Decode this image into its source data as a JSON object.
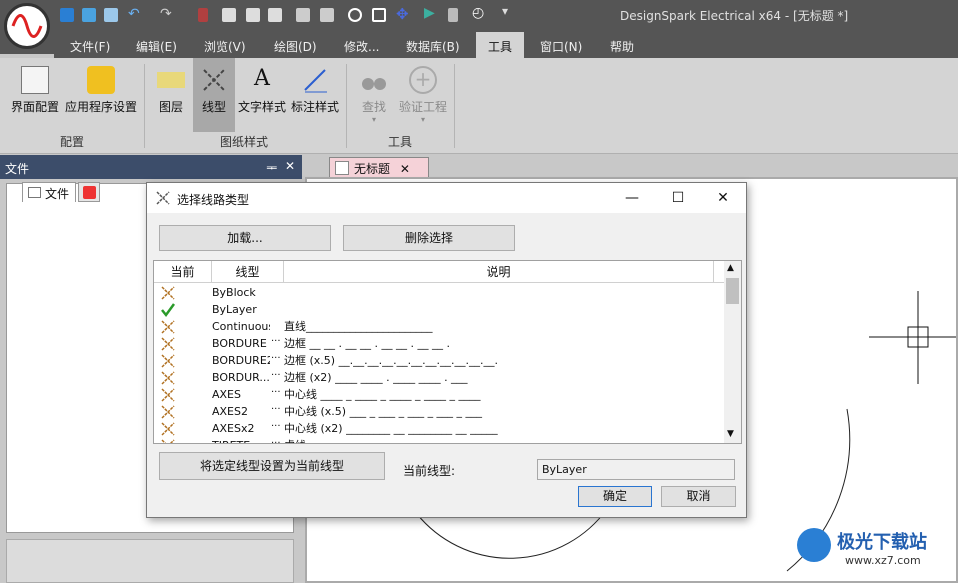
{
  "app": {
    "title": "DesignSpark Electrical x64 - [无标题 *]"
  },
  "menus": [
    "文件(F)",
    "编辑(E)",
    "浏览(V)",
    "绘图(D)",
    "修改...",
    "数据库(B)",
    "工具",
    "窗口(N)",
    "帮助"
  ],
  "ribbon": {
    "buttons": {
      "ui_config": "界面配置",
      "app_settings": "应用程序设置",
      "layers": "图层",
      "linetype": "线型",
      "text_style": "文字样式",
      "dim_style": "标注样式",
      "find": "查找",
      "verify": "验证工程"
    },
    "groups": {
      "config": "配置",
      "sheet_style": "图纸样式",
      "tools": "工具"
    }
  },
  "left_panel": {
    "title": "文件",
    "tab_label": "文件",
    "pin": "ᆍ",
    "close": "✕"
  },
  "doc_tab": {
    "label": "无标题",
    "close": "✕"
  },
  "dialog": {
    "title": "选择线路类型",
    "load_button": "加载...",
    "delete_button": "删除选择",
    "columns": {
      "current": "当前",
      "linetype": "线型",
      "description": "说明"
    },
    "rows": [
      {
        "name": "ByBlock",
        "desc": "",
        "icon": "linetype-icon"
      },
      {
        "name": "ByLayer",
        "desc": "",
        "icon": "check-icon"
      },
      {
        "name": "Continuous",
        "desc": "直线_______________________",
        "icon": "linetype-icon"
      },
      {
        "name": "BORDURE",
        "dots": "···",
        "desc": "边框 __ __ . __ __ . __ __ . __ __ .",
        "icon": "linetype-icon"
      },
      {
        "name": "BORDURE2",
        "dots": "···",
        "desc": "边框 (x.5) __.__.__.__.__.__.__.__.__.__.__.",
        "icon": "linetype-icon"
      },
      {
        "name": "BORDUR...",
        "dots": "···",
        "desc": "边框 (x2) ____  ____  .  ____  ____  .  ___",
        "icon": "linetype-icon"
      },
      {
        "name": "AXES",
        "dots": "···",
        "desc": "中心线 ____ _ ____ _ ____ _ ____ _ ____",
        "icon": "linetype-icon"
      },
      {
        "name": "AXES2",
        "dots": "···",
        "desc": "中心线 (x.5) ___ _ ___ _ ___ _ ___ _ ___",
        "icon": "linetype-icon"
      },
      {
        "name": "AXESx2",
        "dots": "···",
        "desc": "中心线 (x2) ________  __  ________  __  _____",
        "icon": "linetype-icon"
      },
      {
        "name": "TIRETE",
        "dots": "···",
        "desc": "虚线 ___",
        "icon": "linetype-icon"
      }
    ],
    "set_current_button": "将选定线型设置为当前线型",
    "current_label": "当前线型:",
    "current_value": "ByLayer",
    "ok_button": "确定",
    "cancel_button": "取消"
  },
  "watermark": {
    "name": "极光下载站",
    "url": "www.xz7.com"
  }
}
